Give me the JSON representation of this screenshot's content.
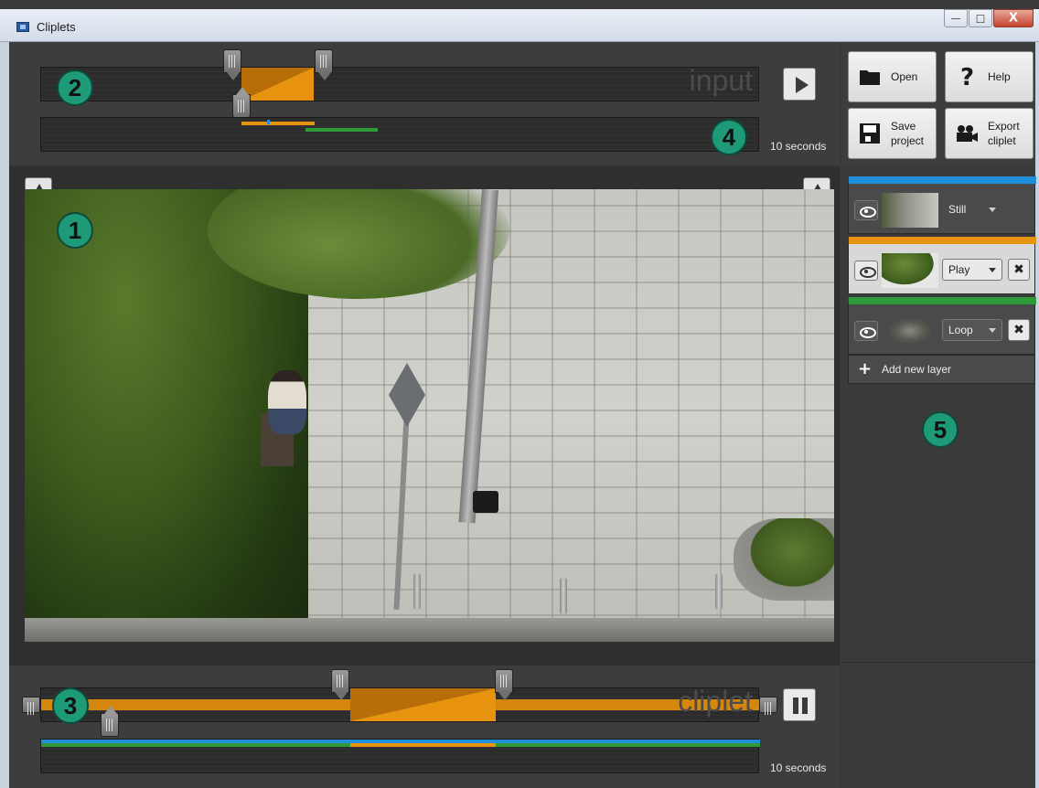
{
  "window": {
    "title": "Cliplets",
    "buttons": {
      "minimize": "—",
      "maximize": "□",
      "close": "X"
    }
  },
  "input_panel": {
    "track_label": "input",
    "duration_label": "10 seconds",
    "badge_top": "2",
    "badge_bottom": "4"
  },
  "video_panel": {
    "badge": "1"
  },
  "cliplet_panel": {
    "track_label": "cliplet",
    "duration_label": "10 seconds",
    "badge": "3"
  },
  "toolbar": {
    "open": "Open",
    "help": "Help",
    "save_line1": "Save",
    "save_line2": "project",
    "export_line1": "Export",
    "export_line2": "cliplet"
  },
  "layers": {
    "items": [
      {
        "mode": "Still",
        "color": "#1e8fd8",
        "active": false
      },
      {
        "mode": "Play",
        "color": "#e8930f",
        "active": true
      },
      {
        "mode": "Loop",
        "color": "#2f9a3a",
        "active": false
      }
    ],
    "add_label": "Add new layer",
    "badge": "5"
  },
  "colors": {
    "accent_orange": "#e8930f",
    "accent_blue": "#1e8fd8",
    "accent_green": "#2f9a3a",
    "badge_green": "#1f9a78"
  }
}
